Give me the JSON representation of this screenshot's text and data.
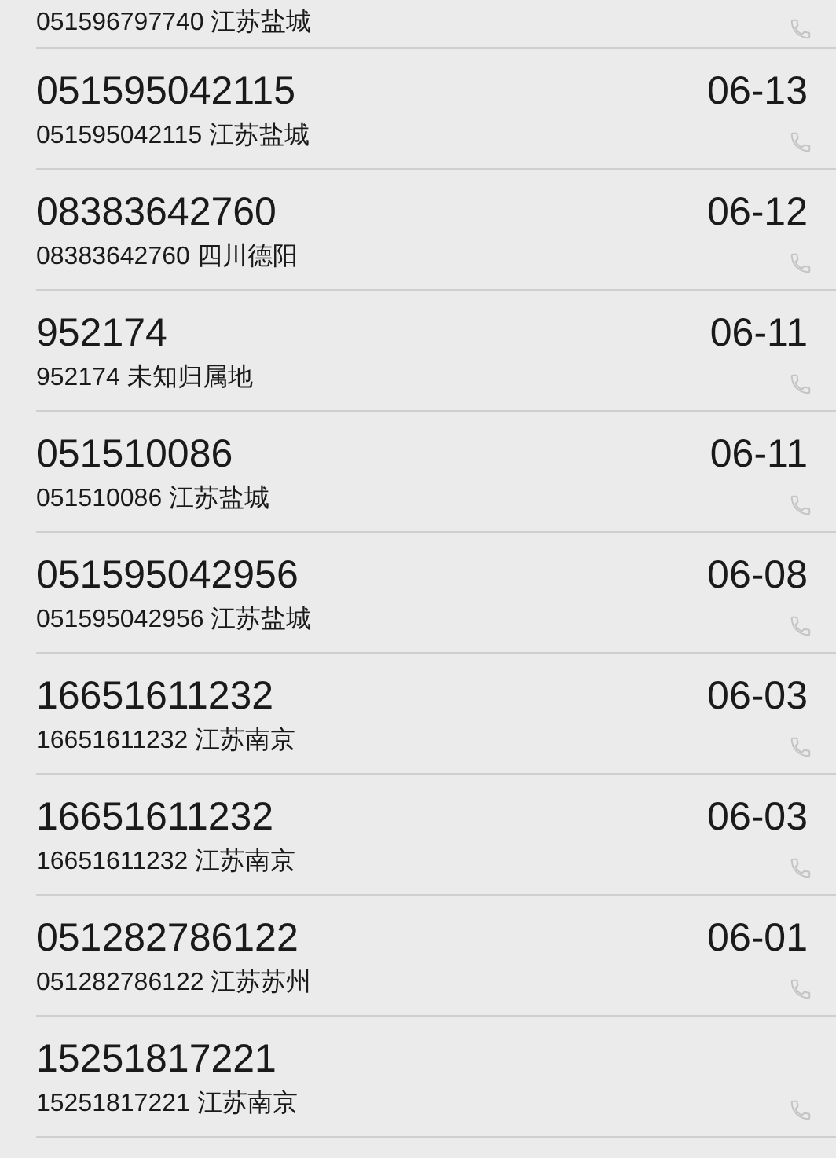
{
  "calls": [
    {
      "subtitle": "051596797740 江苏盐城"
    },
    {
      "number": "051595042115",
      "date": "06-13",
      "subtitle": "051595042115 江苏盐城"
    },
    {
      "number": "08383642760",
      "date": "06-12",
      "subtitle": "08383642760 四川德阳"
    },
    {
      "number": "952174",
      "date": "06-11",
      "subtitle": "952174 未知归属地"
    },
    {
      "number": "051510086",
      "date": "06-11",
      "subtitle": "051510086 江苏盐城"
    },
    {
      "number": "051595042956",
      "date": "06-08",
      "subtitle": "051595042956 江苏盐城"
    },
    {
      "number": "16651611232",
      "date": "06-03",
      "subtitle": "16651611232 江苏南京"
    },
    {
      "number": "16651611232",
      "date": "06-03",
      "subtitle": "16651611232 江苏南京"
    },
    {
      "number": "051282786122",
      "date": "06-01",
      "subtitle": "051282786122 江苏苏州"
    },
    {
      "number": "15251817221",
      "subtitle": "15251817221 江苏南京"
    }
  ]
}
